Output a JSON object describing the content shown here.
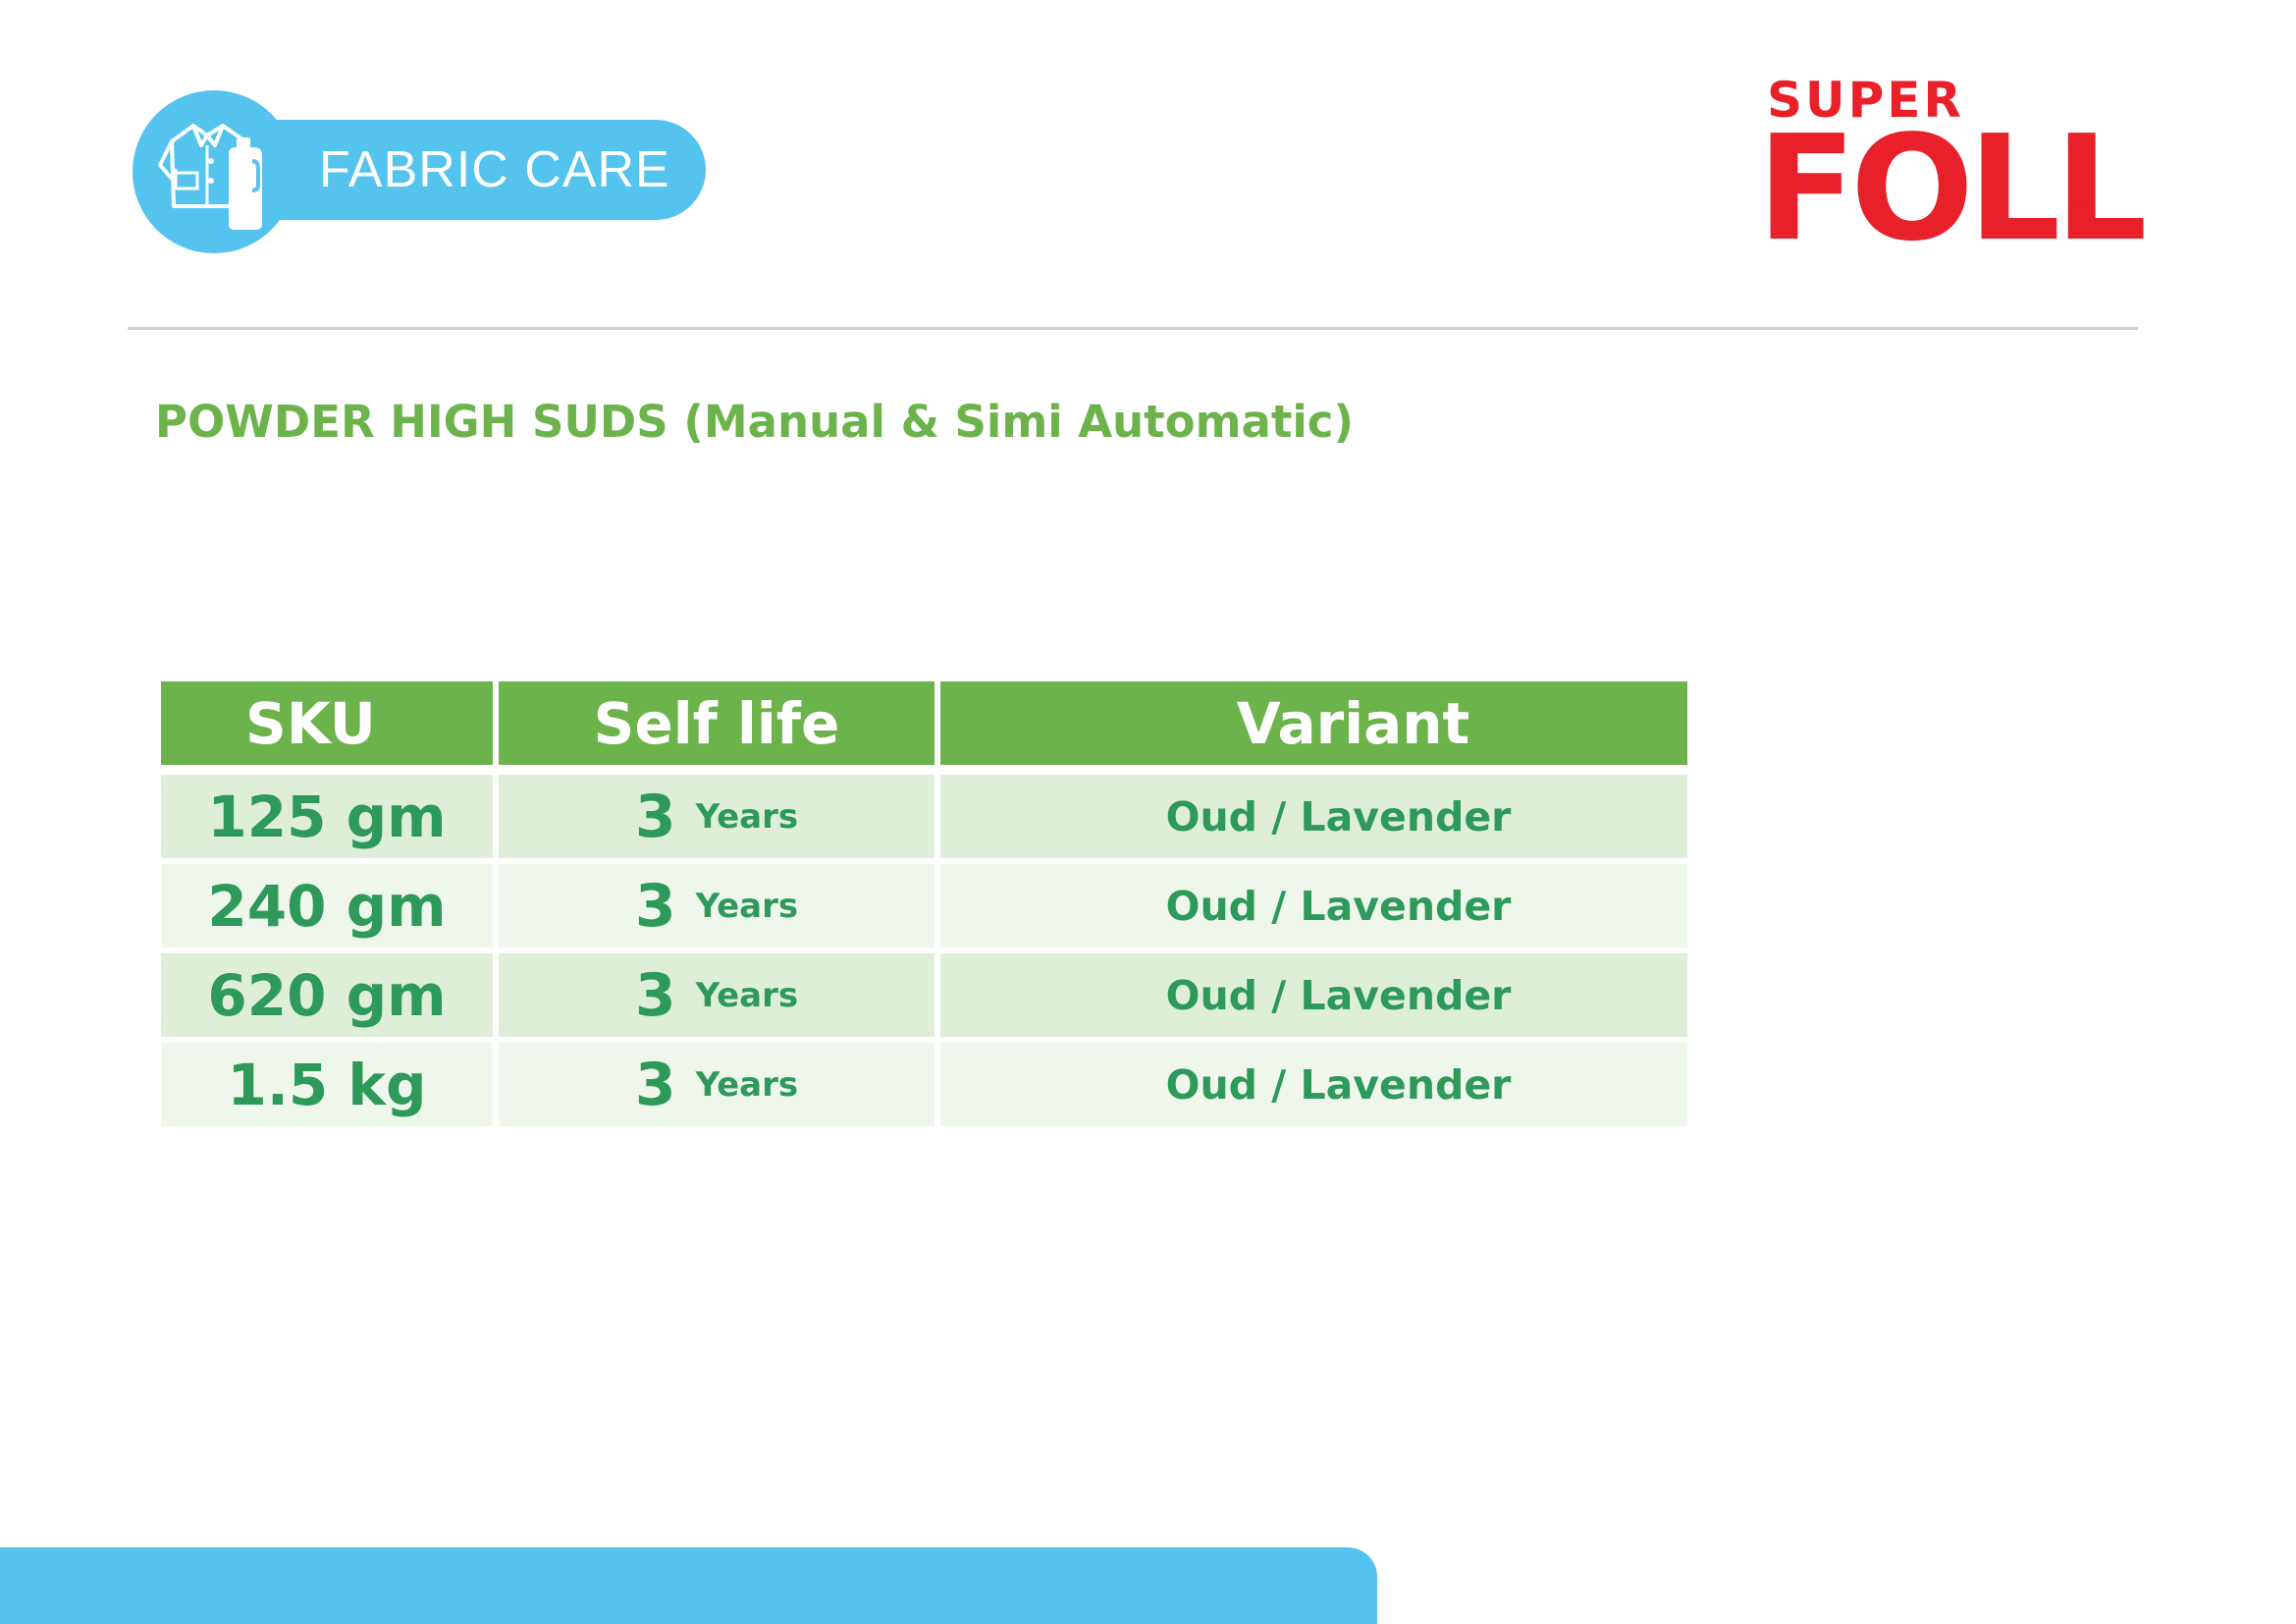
{
  "category": {
    "label": "FABRIC CARE",
    "icon": "shirt-and-detergent-bottle-icon",
    "color": "#54c3ee"
  },
  "brand": {
    "super": "SUPER",
    "name": "FOLL",
    "registered": "®",
    "color": "#e8202a"
  },
  "section": {
    "title": "POWDER HIGH SUDS (Manual & Simi Automatic)",
    "color": "#6db34b"
  },
  "table": {
    "headers": {
      "sku": "SKU",
      "life": "Self life",
      "variant": "Variant"
    },
    "rows": [
      {
        "sku": "125 gm",
        "life_value": "3",
        "life_unit": "Years",
        "variant": "Oud / Lavender"
      },
      {
        "sku": "240 gm",
        "life_value": "3",
        "life_unit": "Years",
        "variant": "Oud / Lavender"
      },
      {
        "sku": "620 gm",
        "life_value": "3",
        "life_unit": "Years",
        "variant": "Oud / Lavender"
      },
      {
        "sku": "1.5 kg",
        "life_value": "3",
        "life_unit": "Years",
        "variant": "Oud / Lavender"
      }
    ],
    "header_color": "#6db34b",
    "text_color": "#2e9a59"
  }
}
